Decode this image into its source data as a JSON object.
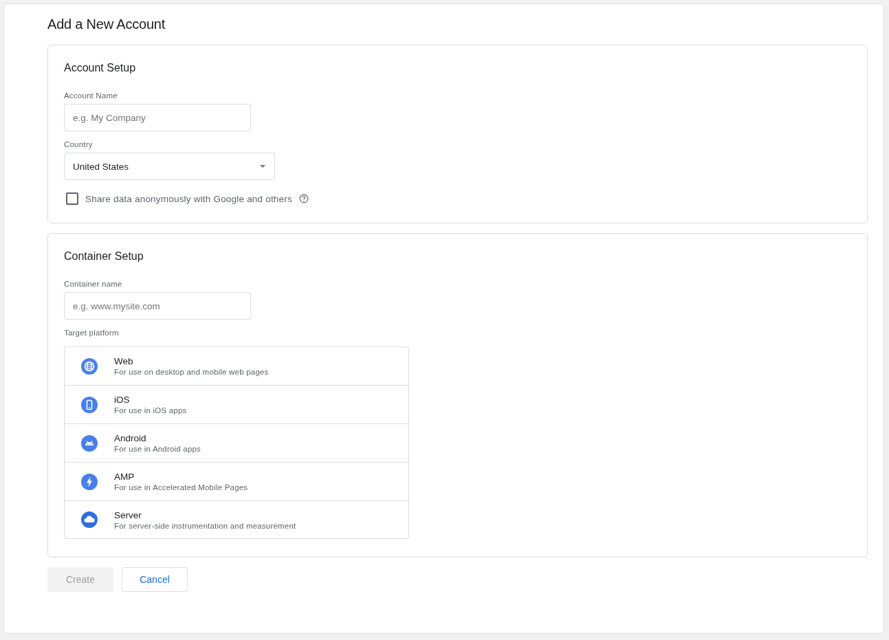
{
  "title": "Add a New Account",
  "account_setup": {
    "heading": "Account Setup",
    "account_name": {
      "label": "Account Name",
      "placeholder": "e.g. My Company"
    },
    "country": {
      "label": "Country",
      "value": "United States"
    },
    "share_data": {
      "label": "Share data anonymously with Google and others",
      "checked": false
    }
  },
  "container_setup": {
    "heading": "Container Setup",
    "container_name": {
      "label": "Container name",
      "placeholder": "e.g. www.mysite.com"
    },
    "target_platform": {
      "label": "Target platform",
      "options": [
        {
          "kind": "web",
          "name": "Web",
          "description": "For use on desktop and mobile web pages"
        },
        {
          "kind": "ios",
          "name": "iOS",
          "description": "For use in iOS apps"
        },
        {
          "kind": "android",
          "name": "Android",
          "description": "For use in Android apps"
        },
        {
          "kind": "amp",
          "name": "AMP",
          "description": "For use in Accelerated Mobile Pages"
        },
        {
          "kind": "server",
          "name": "Server",
          "description": "For server-side instrumentation and measurement"
        }
      ]
    }
  },
  "buttons": [
    {
      "kind": "primary",
      "label": "Create",
      "disabled": true
    },
    {
      "kind": "secondary",
      "label": "Cancel",
      "disabled": false
    }
  ]
}
